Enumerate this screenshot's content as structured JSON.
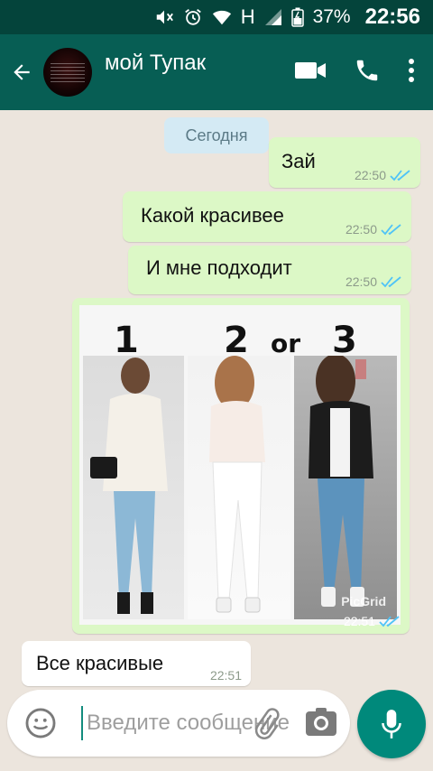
{
  "status_bar": {
    "network_letter": "H",
    "battery_percent": "37%",
    "time": "22:56"
  },
  "header": {
    "contact_name": "мой Тупак"
  },
  "chat": {
    "date_chip": "Сегодня",
    "messages": [
      {
        "direction": "out",
        "text": "Зай",
        "time": "22:50",
        "status": "read"
      },
      {
        "direction": "out",
        "text": "Какой красивее",
        "time": "22:50",
        "status": "read"
      },
      {
        "direction": "out",
        "text": "И мне подходит",
        "time": "22:50",
        "status": "read"
      },
      {
        "direction": "out",
        "type": "image",
        "time": "22:51",
        "status": "read",
        "image_labels": {
          "n1": "1",
          "n2": "2",
          "or": "or",
          "n3": "3",
          "watermark": "PicGrid"
        }
      },
      {
        "direction": "in",
        "text": "Все красивые",
        "time": "22:51"
      }
    ]
  },
  "composer": {
    "placeholder": "Введите сообщение"
  },
  "colors": {
    "header": "#075e54",
    "status_bar": "#04443b",
    "outgoing_bubble": "#dcf8c6",
    "incoming_bubble": "#ffffff",
    "read_ticks": "#4fc3f7",
    "mic_button": "#00897b",
    "chat_background": "#ece5dd"
  },
  "icons": {
    "status": [
      "mute-icon",
      "alarm-icon",
      "wifi-icon",
      "signal-icon",
      "battery-icon"
    ],
    "header": [
      "back-arrow-icon",
      "video-call-icon",
      "phone-icon",
      "more-vert-icon"
    ],
    "composer": [
      "emoji-icon",
      "attach-icon",
      "camera-icon",
      "mic-icon"
    ]
  }
}
